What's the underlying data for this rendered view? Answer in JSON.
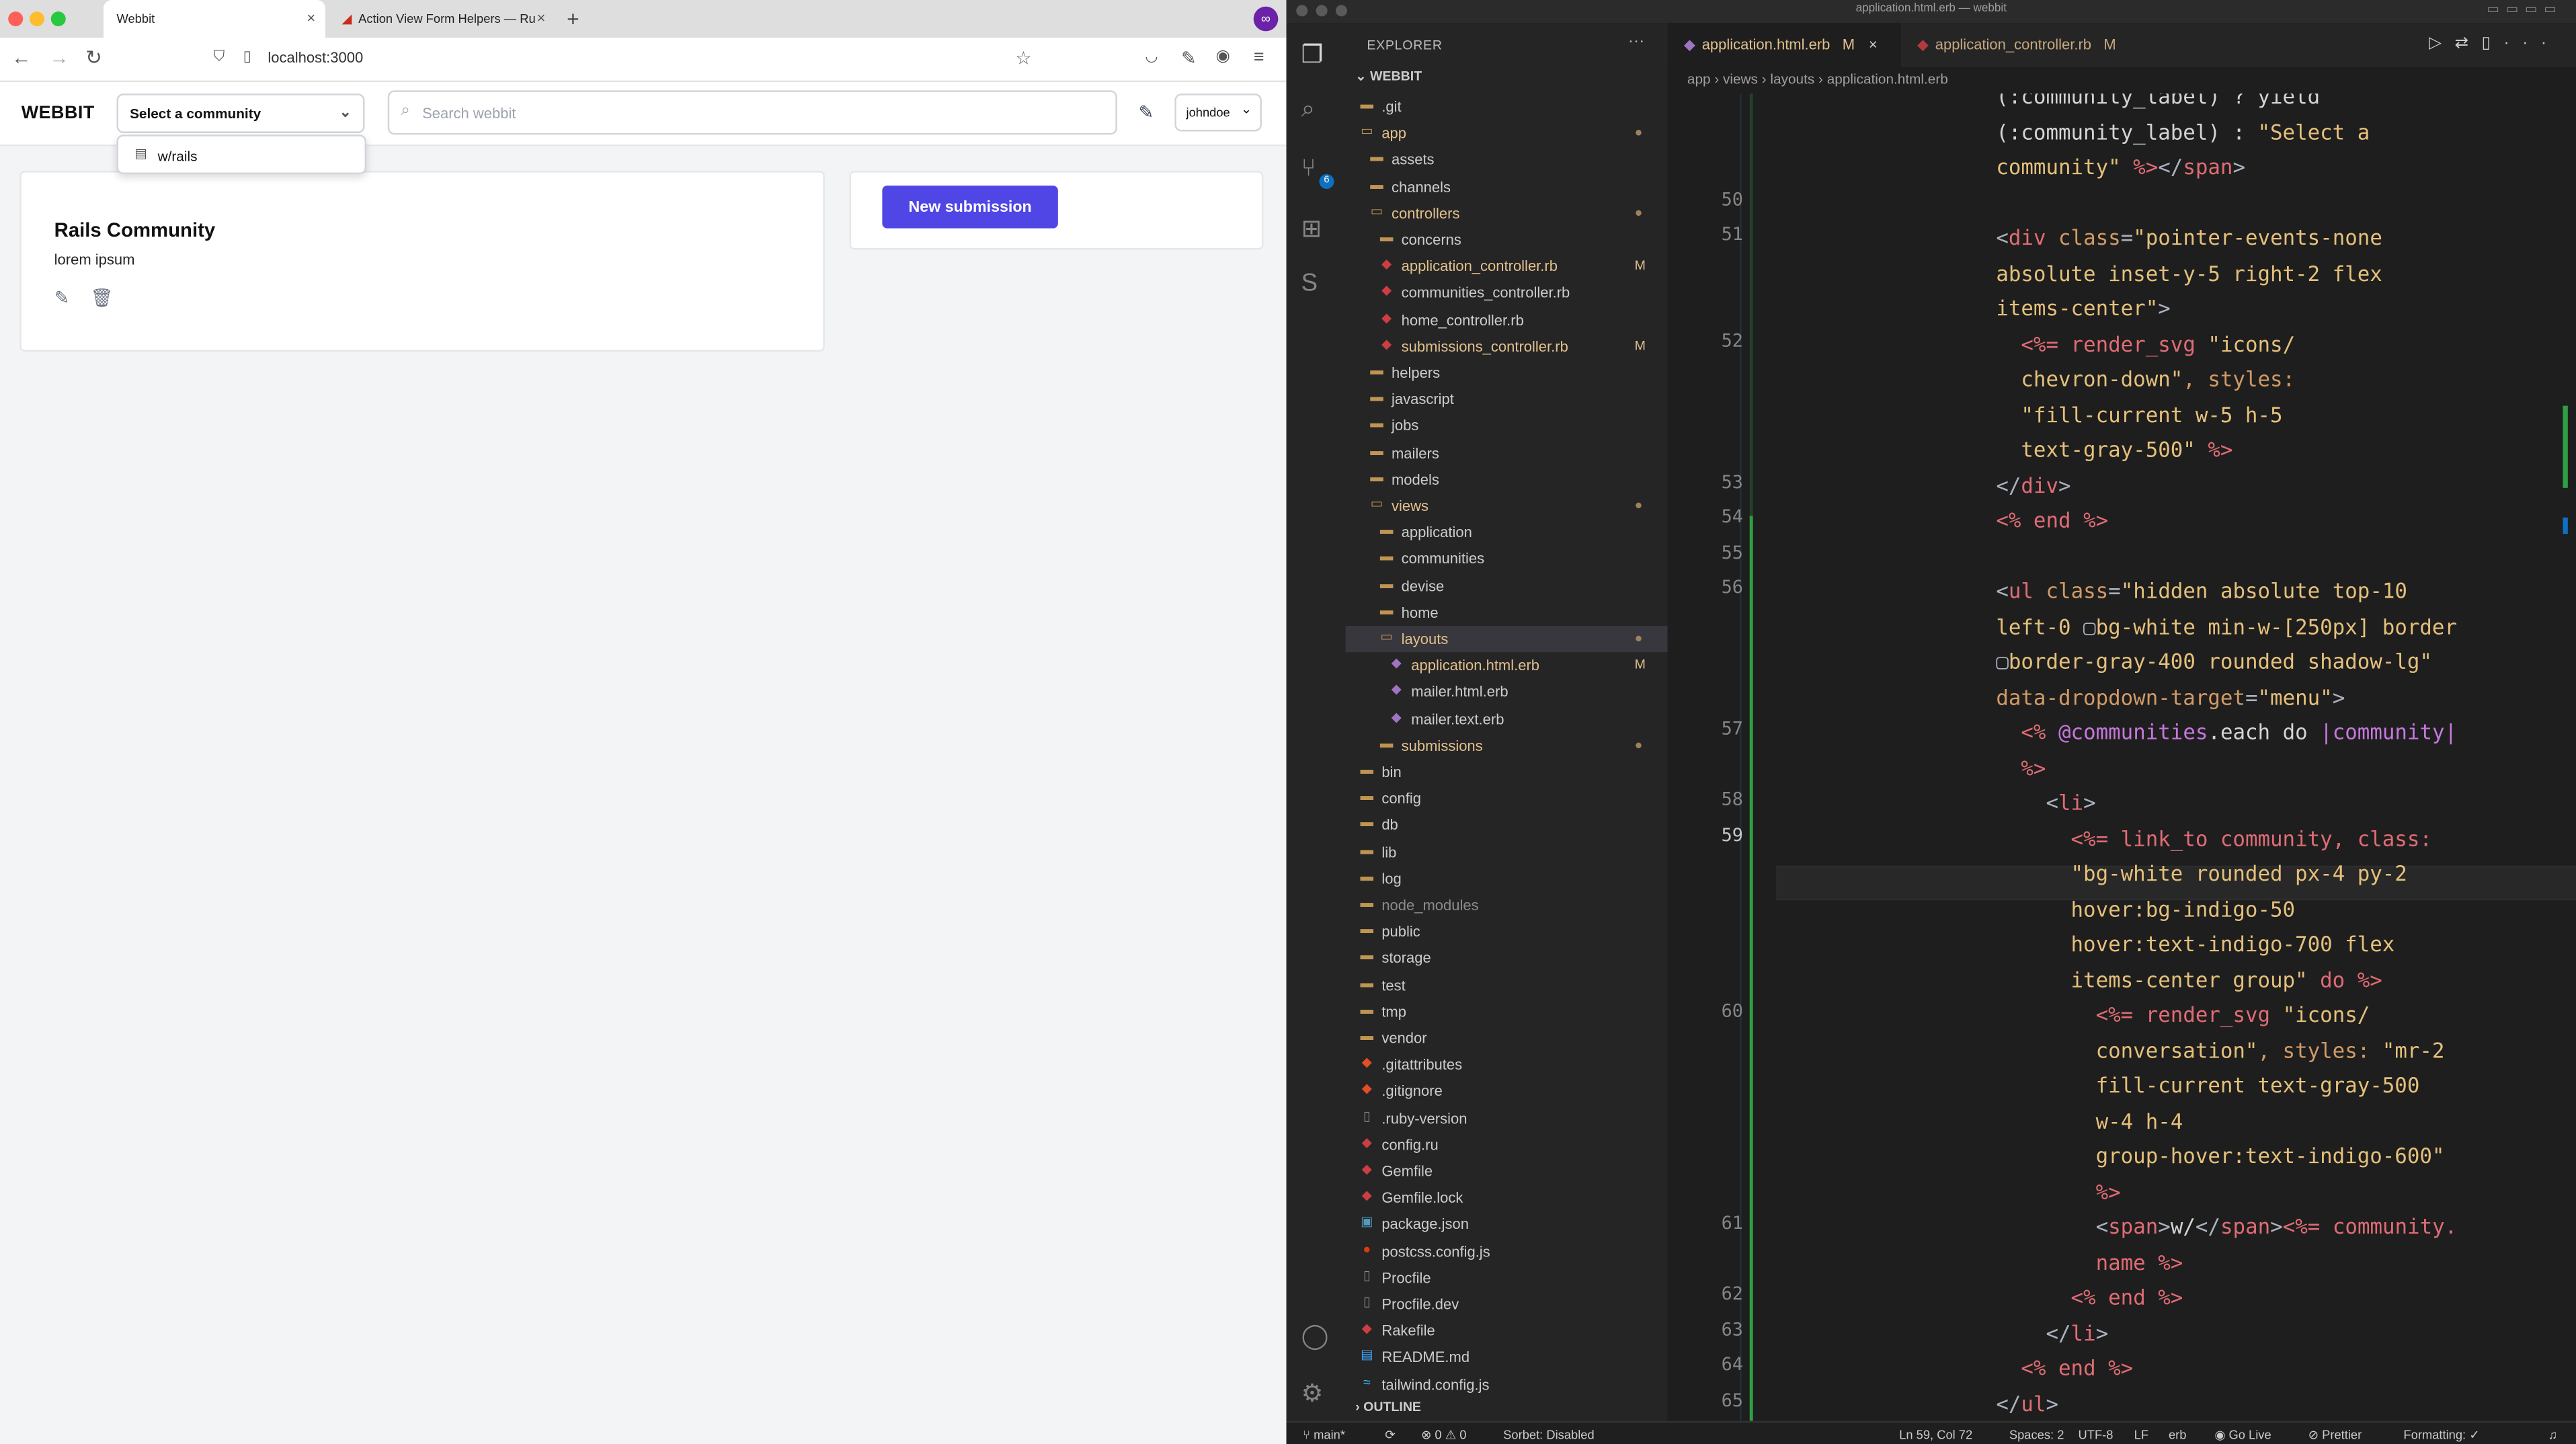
{
  "browser": {
    "tabs": [
      {
        "label": "Webbit",
        "close": "×"
      },
      {
        "label": "Action View Form Helpers — Ru",
        "close": "×"
      }
    ],
    "new_tab": "+",
    "url": "localhost:3000"
  },
  "app": {
    "logo": "WEBBIT",
    "community_select": "Select a community",
    "search_placeholder": "Search webbit",
    "user_menu": "johndoe",
    "dropdown_item": "w/rails",
    "card": {
      "title": "Rails Community",
      "description": "lorem ipsum"
    },
    "new_submission": "New submission"
  },
  "vscode": {
    "window_title": "application.html.erb — webbit",
    "explorer_header": "EXPLORER",
    "root_folder": "WEBBIT",
    "outline_header": "OUTLINE",
    "tree": [
      {
        "name": ".git",
        "depth": 0,
        "type": "folder",
        "color": "#cccccc",
        "mark": ""
      },
      {
        "name": "app",
        "depth": 0,
        "type": "folder-open",
        "color": "#e2c08d",
        "mark": "●"
      },
      {
        "name": "assets",
        "depth": 1,
        "type": "folder",
        "color": "#cccccc",
        "mark": ""
      },
      {
        "name": "channels",
        "depth": 1,
        "type": "folder",
        "color": "#cccccc",
        "mark": ""
      },
      {
        "name": "controllers",
        "depth": 1,
        "type": "folder-open",
        "color": "#e2c08d",
        "mark": "●"
      },
      {
        "name": "concerns",
        "depth": 2,
        "type": "folder",
        "color": "#cccccc",
        "mark": ""
      },
      {
        "name": "application_controller.rb",
        "depth": 2,
        "type": "ruby",
        "color": "#e2c08d",
        "mark": "M"
      },
      {
        "name": "communities_controller.rb",
        "depth": 2,
        "type": "ruby",
        "color": "#cccccc",
        "mark": ""
      },
      {
        "name": "home_controller.rb",
        "depth": 2,
        "type": "ruby",
        "color": "#cccccc",
        "mark": ""
      },
      {
        "name": "submissions_controller.rb",
        "depth": 2,
        "type": "ruby",
        "color": "#e2c08d",
        "mark": "M"
      },
      {
        "name": "helpers",
        "depth": 1,
        "type": "folder",
        "color": "#cccccc",
        "mark": ""
      },
      {
        "name": "javascript",
        "depth": 1,
        "type": "folder",
        "color": "#cccccc",
        "mark": ""
      },
      {
        "name": "jobs",
        "depth": 1,
        "type": "folder",
        "color": "#cccccc",
        "mark": ""
      },
      {
        "name": "mailers",
        "depth": 1,
        "type": "folder",
        "color": "#cccccc",
        "mark": ""
      },
      {
        "name": "models",
        "depth": 1,
        "type": "folder",
        "color": "#cccccc",
        "mark": ""
      },
      {
        "name": "views",
        "depth": 1,
        "type": "folder-open",
        "color": "#e2c08d",
        "mark": "●"
      },
      {
        "name": "application",
        "depth": 2,
        "type": "folder",
        "color": "#cccccc",
        "mark": ""
      },
      {
        "name": "communities",
        "depth": 2,
        "type": "folder",
        "color": "#cccccc",
        "mark": ""
      },
      {
        "name": "devise",
        "depth": 2,
        "type": "folder",
        "color": "#cccccc",
        "mark": ""
      },
      {
        "name": "home",
        "depth": 2,
        "type": "folder",
        "color": "#cccccc",
        "mark": ""
      },
      {
        "name": "layouts",
        "depth": 2,
        "type": "folder-open",
        "color": "#e2c08d",
        "mark": "●",
        "selected": true
      },
      {
        "name": "application.html.erb",
        "depth": 3,
        "type": "erb",
        "color": "#e2c08d",
        "mark": "M"
      },
      {
        "name": "mailer.html.erb",
        "depth": 3,
        "type": "erb",
        "color": "#cccccc",
        "mark": ""
      },
      {
        "name": "mailer.text.erb",
        "depth": 3,
        "type": "erb",
        "color": "#cccccc",
        "mark": ""
      },
      {
        "name": "submissions",
        "depth": 2,
        "type": "folder",
        "color": "#e2c08d",
        "mark": "●"
      },
      {
        "name": "bin",
        "depth": 0,
        "type": "folder",
        "color": "#cccccc",
        "mark": ""
      },
      {
        "name": "config",
        "depth": 0,
        "type": "folder",
        "color": "#cccccc",
        "mark": ""
      },
      {
        "name": "db",
        "depth": 0,
        "type": "folder",
        "color": "#cccccc",
        "mark": ""
      },
      {
        "name": "lib",
        "depth": 0,
        "type": "folder",
        "color": "#cccccc",
        "mark": ""
      },
      {
        "name": "log",
        "depth": 0,
        "type": "folder",
        "color": "#cccccc",
        "mark": ""
      },
      {
        "name": "node_modules",
        "depth": 0,
        "type": "folder",
        "color": "#8c8c8c",
        "mark": ""
      },
      {
        "name": "public",
        "depth": 0,
        "type": "folder",
        "color": "#cccccc",
        "mark": ""
      },
      {
        "name": "storage",
        "depth": 0,
        "type": "folder",
        "color": "#cccccc",
        "mark": ""
      },
      {
        "name": "test",
        "depth": 0,
        "type": "folder",
        "color": "#cccccc",
        "mark": ""
      },
      {
        "name": "tmp",
        "depth": 0,
        "type": "folder",
        "color": "#cccccc",
        "mark": ""
      },
      {
        "name": "vendor",
        "depth": 0,
        "type": "folder",
        "color": "#cccccc",
        "mark": ""
      },
      {
        "name": ".gitattributes",
        "depth": 0,
        "type": "git",
        "color": "#cccccc",
        "mark": ""
      },
      {
        "name": ".gitignore",
        "depth": 0,
        "type": "git",
        "color": "#cccccc",
        "mark": ""
      },
      {
        "name": ".ruby-version",
        "depth": 0,
        "type": "file",
        "color": "#cccccc",
        "mark": ""
      },
      {
        "name": "config.ru",
        "depth": 0,
        "type": "ruby",
        "color": "#cccccc",
        "mark": ""
      },
      {
        "name": "Gemfile",
        "depth": 0,
        "type": "ruby",
        "color": "#cccccc",
        "mark": ""
      },
      {
        "name": "Gemfile.lock",
        "depth": 0,
        "type": "ruby",
        "color": "#cccccc",
        "mark": ""
      },
      {
        "name": "package.json",
        "depth": 0,
        "type": "json",
        "color": "#cccccc",
        "mark": ""
      },
      {
        "name": "postcss.config.js",
        "depth": 0,
        "type": "postcss",
        "color": "#cccccc",
        "mark": ""
      },
      {
        "name": "Procfile",
        "depth": 0,
        "type": "file",
        "color": "#cccccc",
        "mark": ""
      },
      {
        "name": "Procfile.dev",
        "depth": 0,
        "type": "file",
        "color": "#cccccc",
        "mark": ""
      },
      {
        "name": "Rakefile",
        "depth": 0,
        "type": "ruby",
        "color": "#cccccc",
        "mark": ""
      },
      {
        "name": "README.md",
        "depth": 0,
        "type": "md",
        "color": "#cccccc",
        "mark": ""
      },
      {
        "name": "tailwind.config.js",
        "depth": 0,
        "type": "tailwind",
        "color": "#cccccc",
        "mark": ""
      }
    ],
    "editor_tabs": [
      {
        "name": "application.html.erb",
        "mark": "M",
        "close": "×"
      },
      {
        "name": "application_controller.rb",
        "mark": "M"
      }
    ],
    "breadcrumb": "app › views › layouts › application.html.erb",
    "line_numbers": [
      "50",
      "51",
      "52",
      "53",
      "54",
      "55",
      "56",
      "57",
      "58",
      "59",
      "60",
      "61",
      "62",
      "63",
      "64",
      "65"
    ],
    "status": {
      "branch": "main*",
      "problems": "⊗ 0 ⚠ 0",
      "sorbet": "Sorbet: Disabled",
      "position": "Ln 59, Col 72",
      "spaces": "Spaces: 2",
      "encoding": "UTF-8",
      "eol": "LF",
      "lang": "erb",
      "golive": "Go Live",
      "prettier": "Prettier",
      "formatting": "Formatting: ✓"
    }
  },
  "code_lines": [
    [
      [
        "(:community_label) ? yield",
        "k-plain"
      ]
    ],
    [
      [
        "(:community_label) : ",
        "k-plain"
      ],
      [
        "\"Select a",
        "k-str"
      ]
    ],
    [
      [
        "community\"",
        "k-str"
      ],
      [
        " %>",
        "k-erb"
      ],
      [
        "</",
        "k-punc"
      ],
      [
        "span",
        "k-tag"
      ],
      [
        ">",
        "k-punc"
      ]
    ],
    [
      [
        "",
        "k-plain"
      ]
    ],
    [
      [
        "<",
        "k-punc"
      ],
      [
        "div",
        "k-tag"
      ],
      [
        " class",
        "k-attr"
      ],
      [
        "=",
        "k-punc"
      ],
      [
        "\"pointer-events-none",
        "k-str"
      ]
    ],
    [
      [
        "absolute inset-y-5 right-2 flex",
        "k-str"
      ]
    ],
    [
      [
        "items-center\"",
        "k-str"
      ],
      [
        ">",
        "k-punc"
      ]
    ],
    [
      [
        "  <%=",
        "k-erb"
      ],
      [
        " render_svg ",
        "k-tag"
      ],
      [
        "\"icons/",
        "k-str"
      ]
    ],
    [
      [
        "  chevron-down\"",
        "k-str"
      ],
      [
        ", styles:",
        "k-attr"
      ]
    ],
    [
      [
        "  \"fill-current w-5 h-5",
        "k-str"
      ]
    ],
    [
      [
        "  text-gray-500\"",
        "k-str"
      ],
      [
        " %>",
        "k-erb"
      ]
    ],
    [
      [
        "</",
        "k-punc"
      ],
      [
        "div",
        "k-tag"
      ],
      [
        ">",
        "k-punc"
      ]
    ],
    [
      [
        "<% ",
        "k-erb"
      ],
      [
        "end",
        "k-tag"
      ],
      [
        " %>",
        "k-erb"
      ]
    ],
    [
      [
        "",
        "k-plain"
      ]
    ],
    [
      [
        "<",
        "k-punc"
      ],
      [
        "ul",
        "k-tag"
      ],
      [
        " class",
        "k-attr"
      ],
      [
        "=",
        "k-punc"
      ],
      [
        "\"hidden absolute top-10",
        "k-str"
      ]
    ],
    [
      [
        "left-0 ",
        "k-str"
      ],
      [
        "▢",
        "k-punc"
      ],
      [
        "bg-white min-w-[250px] border",
        "k-str"
      ]
    ],
    [
      [
        "▢",
        "k-punc"
      ],
      [
        "border-gray-400 rounded shadow-lg\"",
        "k-str"
      ]
    ],
    [
      [
        "data-dropdown-target",
        "k-attr"
      ],
      [
        "=",
        "k-punc"
      ],
      [
        "\"menu\"",
        "k-str"
      ],
      [
        ">",
        "k-punc"
      ]
    ],
    [
      [
        "  <% ",
        "k-erb"
      ],
      [
        "@communities",
        "k-var"
      ],
      [
        ".each do ",
        "k-plain"
      ],
      [
        "|community|",
        "k-var"
      ]
    ],
    [
      [
        "  %>",
        "k-erb"
      ]
    ],
    [
      [
        "    <",
        "k-punc"
      ],
      [
        "li",
        "k-tag"
      ],
      [
        ">",
        "k-punc"
      ]
    ],
    [
      [
        "      <%= ",
        "k-erb"
      ],
      [
        "link_to community, class:",
        "k-tag"
      ]
    ],
    [
      [
        "      \"bg-white rounded px-4 py-2",
        "k-str"
      ]
    ],
    [
      [
        "      hover:bg-indigo-50",
        "k-str"
      ]
    ],
    [
      [
        "      hover:text-indigo-700 flex",
        "k-str"
      ]
    ],
    [
      [
        "      items-center group\"",
        "k-str"
      ],
      [
        " do %>",
        "k-erb"
      ]
    ],
    [
      [
        "        <%= ",
        "k-erb"
      ],
      [
        "render_svg ",
        "k-tag"
      ],
      [
        "\"icons/",
        "k-str"
      ]
    ],
    [
      [
        "        conversation\"",
        "k-str"
      ],
      [
        ", styles: ",
        "k-attr"
      ],
      [
        "\"mr-2",
        "k-str"
      ]
    ],
    [
      [
        "        fill-current text-gray-500",
        "k-str"
      ]
    ],
    [
      [
        "        w-4 h-4",
        "k-str"
      ]
    ],
    [
      [
        "        group-hover:text-indigo-600\"",
        "k-str"
      ]
    ],
    [
      [
        "        %>",
        "k-erb"
      ]
    ],
    [
      [
        "        <",
        "k-punc"
      ],
      [
        "span",
        "k-tag"
      ],
      [
        ">",
        "k-punc"
      ],
      [
        "w/",
        "k-plain"
      ],
      [
        "</",
        "k-punc"
      ],
      [
        "span",
        "k-tag"
      ],
      [
        ">",
        "k-punc"
      ],
      [
        "<%= ",
        "k-erb"
      ],
      [
        "community.",
        "k-tag"
      ]
    ],
    [
      [
        "        name",
        "k-tag"
      ],
      [
        " %>",
        "k-erb"
      ]
    ],
    [
      [
        "      <% ",
        "k-erb"
      ],
      [
        "end",
        "k-tag"
      ],
      [
        " %>",
        "k-erb"
      ]
    ],
    [
      [
        "    </",
        "k-punc"
      ],
      [
        "li",
        "k-tag"
      ],
      [
        ">",
        "k-punc"
      ]
    ],
    [
      [
        "  <% ",
        "k-erb"
      ],
      [
        "end",
        "k-tag"
      ],
      [
        " %>",
        "k-erb"
      ]
    ],
    [
      [
        "</",
        "k-punc"
      ],
      [
        "ul",
        "k-tag"
      ],
      [
        ">",
        "k-punc"
      ]
    ]
  ]
}
